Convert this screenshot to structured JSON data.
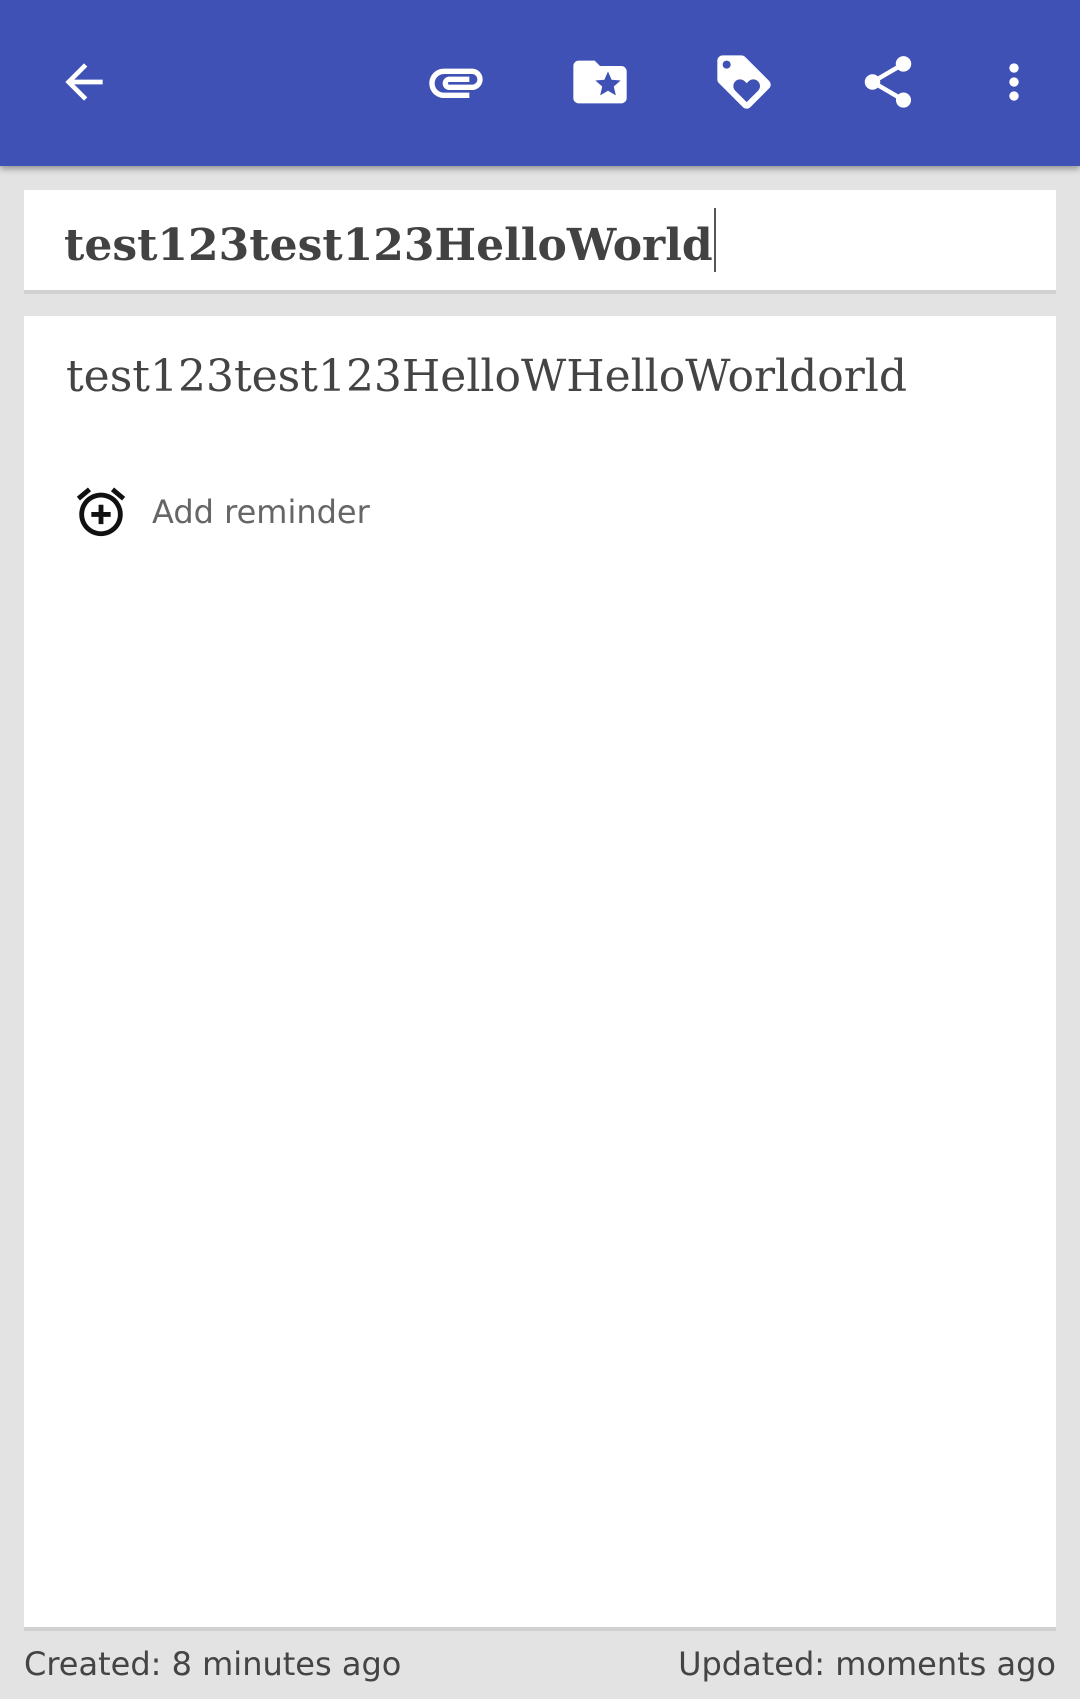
{
  "toolbar": {
    "color": "#3f51b5",
    "icons": [
      "back-arrow-icon",
      "attachment-icon",
      "category-folder-icon",
      "tag-icon",
      "share-icon",
      "more-vert-icon"
    ]
  },
  "note": {
    "title": "test123test123HelloWorld",
    "content": "test123test123HelloWHelloWorldorld"
  },
  "reminder": {
    "label": "Add reminder",
    "icon": "alarm-add-icon"
  },
  "footer": {
    "created": "Created: 8 minutes ago",
    "updated": "Updated: moments ago"
  }
}
